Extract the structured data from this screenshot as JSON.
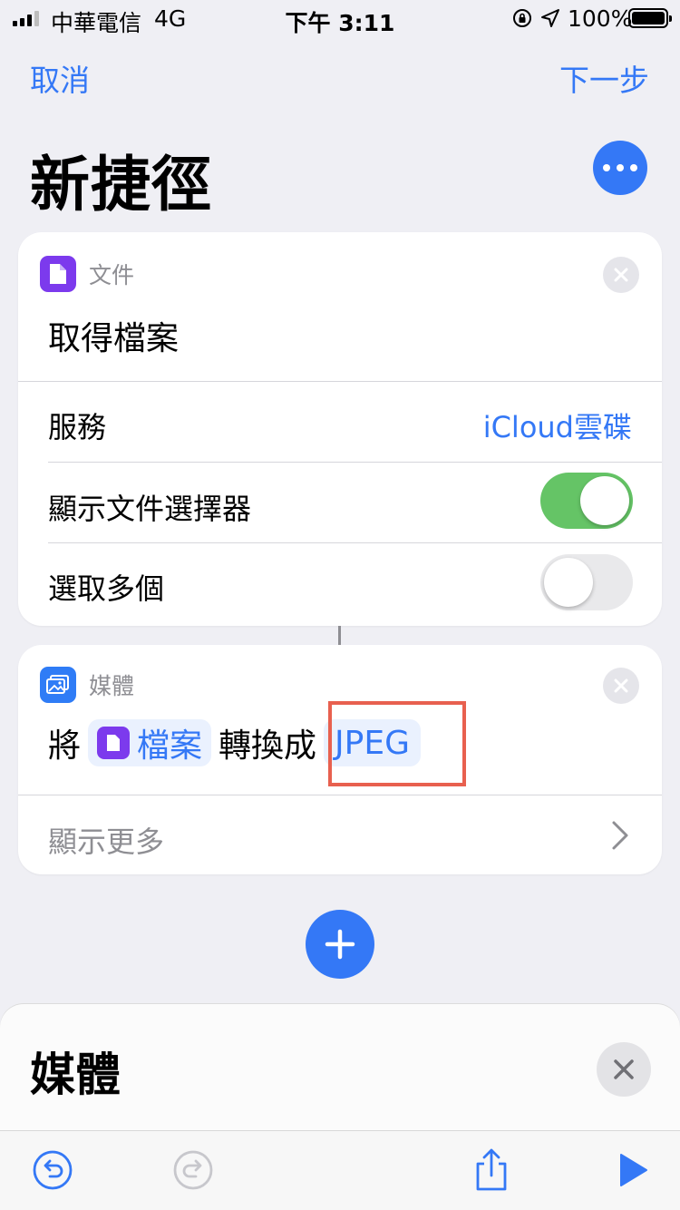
{
  "status_bar": {
    "carrier": "中華電信",
    "network": "4G",
    "time": "下午 3:11",
    "battery": "100%"
  },
  "nav": {
    "cancel": "取消",
    "next": "下一步"
  },
  "title": "新捷徑",
  "file_action": {
    "category": "文件",
    "title": "取得檔案",
    "rows": {
      "service_label": "服務",
      "service_value": "iCloud雲碟",
      "show_picker_label": "顯示文件選擇器",
      "show_picker_on": true,
      "select_multiple_label": "選取多個",
      "select_multiple_on": false
    }
  },
  "media_action": {
    "category": "媒體",
    "prefix": "將",
    "file_token": "檔案",
    "middle": "轉換成",
    "format_token": "JPEG",
    "show_more": "顯示更多"
  },
  "sheet": {
    "title": "媒體"
  },
  "colors": {
    "accent": "#3478f6",
    "toggle_on": "#65c466",
    "highlight": "#e8604f",
    "file_category": "#7c3aed"
  }
}
